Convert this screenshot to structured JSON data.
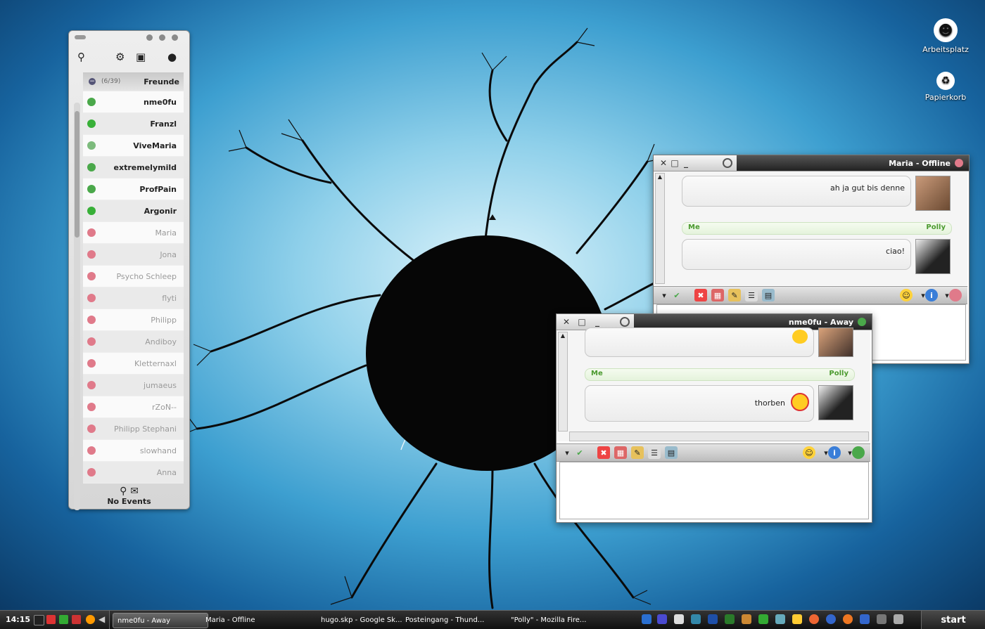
{
  "desktop_icons": [
    {
      "label": "Arbeitsplatz",
      "icon": "panda-computer-icon"
    },
    {
      "label": "Papierkorb",
      "icon": "recycle-bin-icon"
    }
  ],
  "buddy_list": {
    "group": {
      "name": "Freunde",
      "count": "(6/39)"
    },
    "contacts": [
      {
        "name": "nme0fu",
        "status": "away",
        "color": "#4aa84a"
      },
      {
        "name": "Franzl",
        "status": "online",
        "color": "#38b038"
      },
      {
        "name": "ViveMaria",
        "status": "na",
        "color": "#7dbb7d"
      },
      {
        "name": "extremelymild",
        "status": "away",
        "color": "#4aa84a"
      },
      {
        "name": "ProfPain",
        "status": "away",
        "color": "#4aa84a"
      },
      {
        "name": "Argonir",
        "status": "online",
        "color": "#38b038"
      },
      {
        "name": "Maria",
        "status": "offline",
        "color": "#e07a8a"
      },
      {
        "name": "Jona",
        "status": "offline",
        "color": "#e07a8a"
      },
      {
        "name": "Psycho Schleep",
        "status": "offline",
        "color": "#e07a8a"
      },
      {
        "name": "flyti",
        "status": "offline",
        "color": "#e07a8a"
      },
      {
        "name": "Philipp",
        "status": "offline",
        "color": "#e07a8a"
      },
      {
        "name": "Andiboy",
        "status": "offline",
        "color": "#e07a8a"
      },
      {
        "name": "Kletternaxl",
        "status": "offline",
        "color": "#e07a8a"
      },
      {
        "name": "jumaeus",
        "status": "offline",
        "color": "#e07a8a"
      },
      {
        "name": "rZoN--",
        "status": "offline",
        "color": "#e07a8a"
      },
      {
        "name": "Philipp Stephani",
        "status": "offline",
        "color": "#e07a8a"
      },
      {
        "name": "slowhand",
        "status": "offline",
        "color": "#e07a8a"
      },
      {
        "name": "Anna",
        "status": "offline",
        "color": "#e07a8a"
      }
    ],
    "footer": "No Events"
  },
  "chat_maria": {
    "title": "Maria - Offline",
    "messages": [
      {
        "text": "ah ja gut bis denne"
      },
      {
        "text": "ciao!"
      }
    ],
    "sender_label": "Polly",
    "me_label": "Me"
  },
  "chat_nme0fu": {
    "title": "nme0fu - Away",
    "messages": [
      {
        "text": ""
      },
      {
        "text": "thorben"
      }
    ],
    "sender_label": "Polly",
    "me_label": "Me"
  },
  "taskbar": {
    "start_label": "start",
    "clock": "14:15",
    "tasks": [
      {
        "label": "nme0fu - Away",
        "active": true
      },
      {
        "label": "Maria - Offline",
        "active": false
      },
      {
        "label": "hugo.skp - Google Sk...",
        "active": false
      },
      {
        "label": "Posteingang - Thund...",
        "active": false
      },
      {
        "label": "\"Polly\" - Mozilla Fire...",
        "active": false
      }
    ]
  },
  "colors": {
    "online": "#38b038",
    "offline": "#e07a8a",
    "accent_green": "#4b9a2f"
  }
}
